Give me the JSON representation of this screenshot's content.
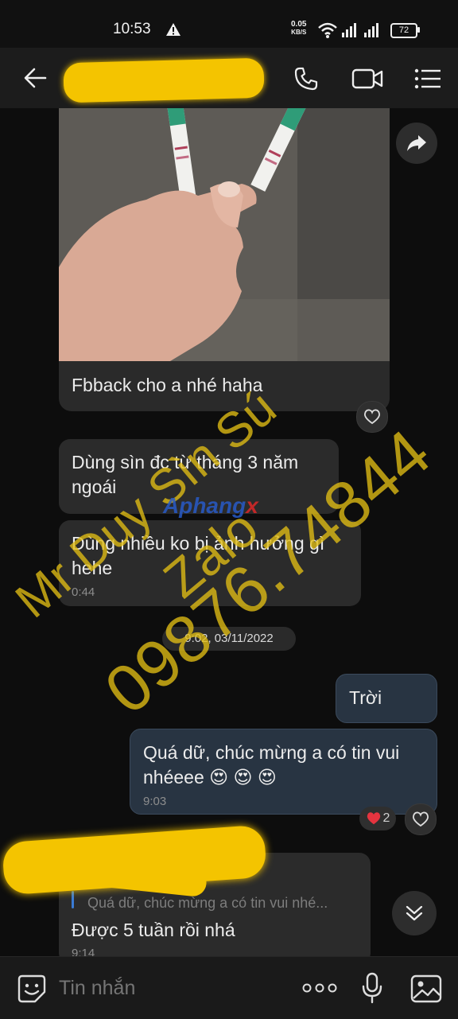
{
  "status_bar": {
    "time": "10:53",
    "net_speed_value": "0.05",
    "net_speed_unit": "KB/S",
    "battery": "72"
  },
  "header": {
    "contact_name": "",
    "icons": [
      "back-arrow-icon",
      "phone-icon",
      "video-call-icon",
      "menu-icon"
    ]
  },
  "messages": {
    "photo_caption": "Fbback cho a nhé haha",
    "incoming_1": "Dùng sìn đc từ tháng 3 năm ngoái",
    "incoming_2": "Dùng nhiều ko bị ảnh hưởng gì hehe",
    "incoming_2_time": "0:44",
    "date_separator": "9:02, 03/11/2022",
    "outgoing_1": "Trời",
    "outgoing_2": "Quá dữ, chúc mừng a có tin vui nhéeee 😍 😍 😍",
    "outgoing_2_time": "9:03",
    "outgoing_2_reaction_count": "2",
    "reply_quote": "Quá dữ, chúc mừng a có tin vui nhé...",
    "reply_text": "Được 5 tuần rồi nhá",
    "reply_time": "9:14"
  },
  "input_bar": {
    "placeholder": "Tin nhắn"
  },
  "watermark": {
    "line1": "Mr Duy Sìn Sú",
    "line2": "Zalo",
    "line3": "09876.74844",
    "logo_main": "Aphang",
    "logo_accent": "x"
  },
  "colors": {
    "background": "#0d0d0d",
    "incoming_bubble": "#2b2b2b",
    "outgoing_bubble": "#283442",
    "redaction_yellow": "#f4c400",
    "watermark": "#e2be14"
  }
}
